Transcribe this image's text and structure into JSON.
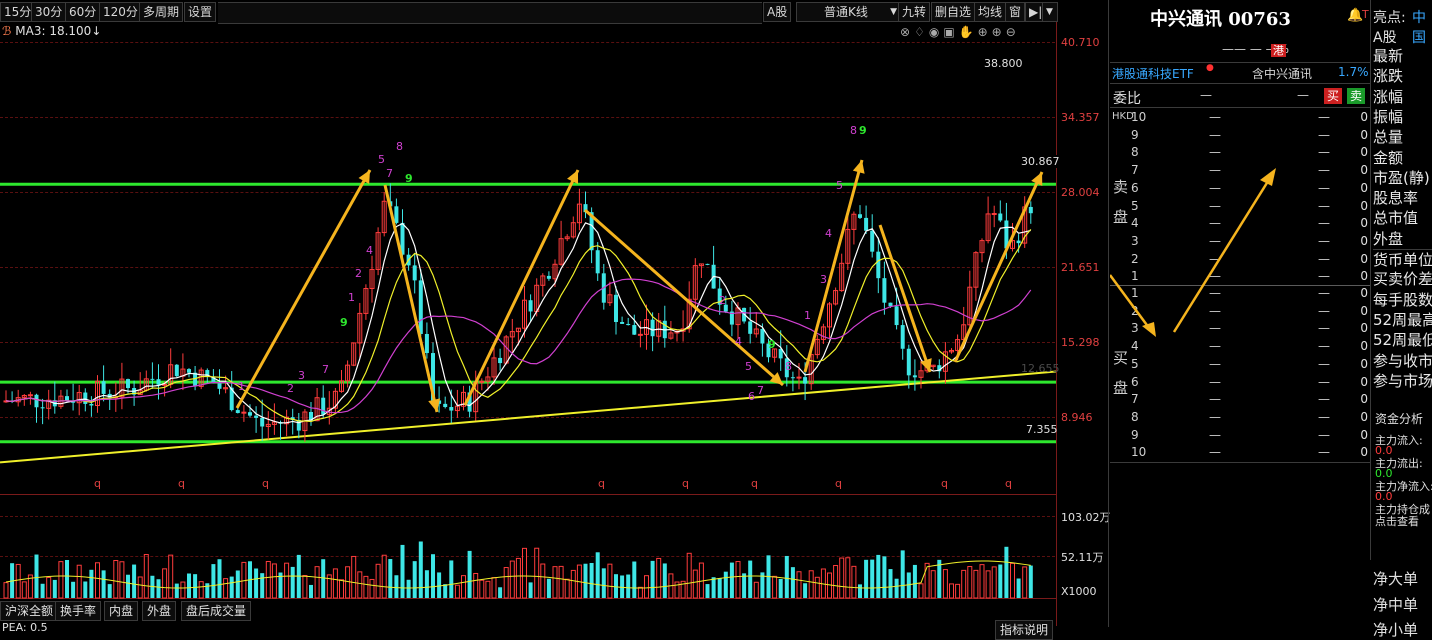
{
  "toolbar": {
    "periods": [
      "15分",
      "30分",
      "60分",
      "120分",
      "多周期",
      "设置"
    ],
    "market": "A股",
    "kline_type": "普通K线",
    "right_buttons": [
      "九转",
      "删自选",
      "均线",
      "窗"
    ]
  },
  "ma_label": "MA3: 18.100",
  "price_axis": [
    "40.710",
    "34.357",
    "28.004",
    "21.651",
    "15.298",
    "8.946"
  ],
  "price_marks": {
    "high": "38.800",
    "resistance": "30.867",
    "mid_support": "12.655",
    "low_support": "7.355"
  },
  "volume_axis": {
    "top": "103.02万",
    "mid": "52.11万",
    "unit": "X1000"
  },
  "q_marker": "q",
  "td_counts": {
    "group1": [
      "2",
      "3",
      "4",
      "5",
      "6",
      "7",
      "8",
      "9"
    ],
    "group1_top": [
      "4",
      "5",
      "6",
      "7",
      "8",
      "9"
    ]
  },
  "bottom_tabs": [
    "沪深全额",
    "换手率",
    "内盘",
    "外盘",
    "盘后成交量"
  ],
  "bottom_partial": [
    "PEA: 0.5",
    "指标说明"
  ],
  "stock": {
    "title": "中兴通讯 00763",
    "change_line": "—— — —%",
    "hk_badge": "港",
    "etf_name": "港股通科技ETF",
    "etf_holding_label": "含中兴通讯",
    "etf_pct": "1.7%",
    "ratio_label": "委比",
    "ratio_val": "—",
    "ratio_val2": "—",
    "buy_btn": "买",
    "sell_btn": "卖",
    "currency": "HKD",
    "sell_label": [
      "卖",
      "盘"
    ],
    "buy_label": [
      "买",
      "盘"
    ],
    "sell_levels": [
      "10",
      "9",
      "8",
      "7",
      "6",
      "5",
      "4",
      "3",
      "2",
      "1"
    ],
    "buy_levels": [
      "1",
      "2",
      "3",
      "4",
      "5",
      "6",
      "7",
      "8",
      "9",
      "10"
    ],
    "dash": "—",
    "zero": "0"
  },
  "fields": {
    "highlight": "亮点:",
    "highlight_val": "中国",
    "market": "A股",
    "items": [
      "最新",
      "涨跌",
      "涨幅",
      "振幅",
      "总量",
      "金额",
      "市盈(静)",
      "股息率",
      "总市值",
      "外盘",
      "货币单位",
      "买卖价差",
      "每手股数",
      "52周最高",
      "52周最低",
      "参与收市",
      "参与市场"
    ]
  },
  "capital": {
    "title": "资金分析",
    "rows": [
      {
        "label": "主力流入:",
        "value": "0.0"
      },
      {
        "label": "主力流出:",
        "value": "0.0"
      },
      {
        "label": "主力净流入:",
        "value": "0.0"
      },
      {
        "label": "主力持仓成",
        "value": "点击查看"
      }
    ],
    "orders": [
      "净大单",
      "净中单",
      "净小单"
    ]
  },
  "colors": {
    "up": "#ff3c3c",
    "down": "#3ee6e6",
    "green_line": "#2ee82e",
    "yellow_line": "#f0f02a",
    "arrow": "#f5b41e"
  }
}
